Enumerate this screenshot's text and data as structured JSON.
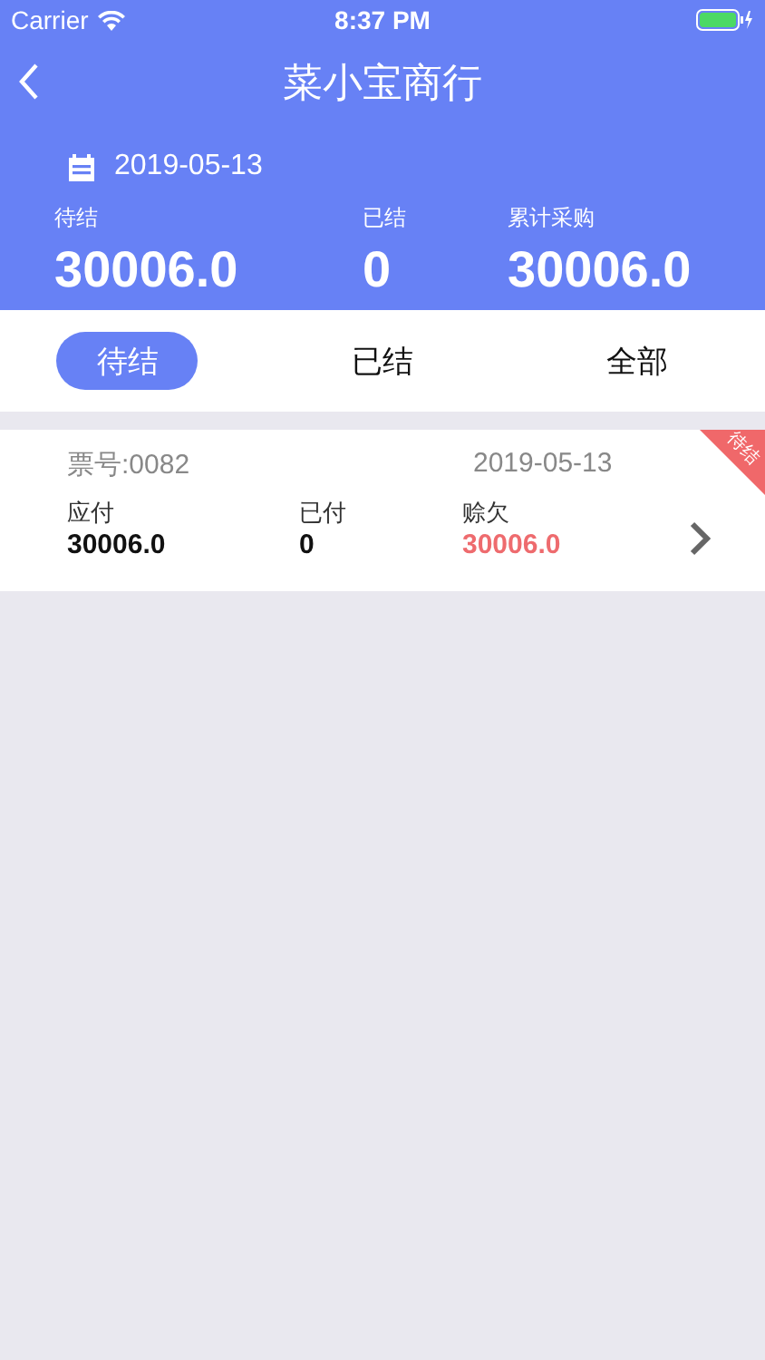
{
  "status_bar": {
    "carrier": "Carrier",
    "time": "8:37 PM"
  },
  "nav": {
    "title": "菜小宝商行"
  },
  "summary": {
    "date": "2019-05-13",
    "stats": [
      {
        "label": "待结",
        "value": "30006.0"
      },
      {
        "label": "已结",
        "value": "0"
      },
      {
        "label": "累计采购",
        "value": "30006.0"
      }
    ]
  },
  "tabs": [
    {
      "label": "待结",
      "selected": true
    },
    {
      "label": "已结",
      "selected": false
    },
    {
      "label": "全部",
      "selected": false
    }
  ],
  "bills": [
    {
      "number": "票号:0082",
      "date": "2019-05-13",
      "badge": "待结",
      "fields": [
        {
          "label": "应付",
          "value": "30006.0",
          "kind": "normal"
        },
        {
          "label": "已付",
          "value": "0",
          "kind": "normal"
        },
        {
          "label": "赊欠",
          "value": "30006.0",
          "kind": "owed"
        }
      ]
    }
  ]
}
